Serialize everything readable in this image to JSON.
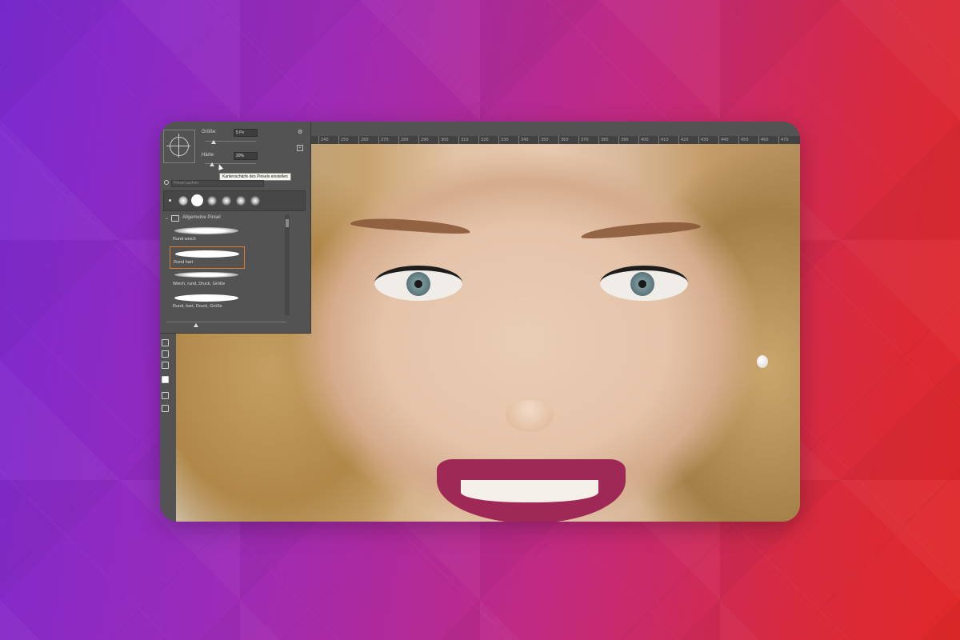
{
  "brush_panel": {
    "size_label": "Größe:",
    "size_value": "5 Px",
    "hardness_label": "Härte:",
    "hardness_value": "20%",
    "tooltip": "Kantenschärfe des Pinsels einstellen",
    "search_placeholder": "Pinsel suchen",
    "folder_label": "Allgemeine Pinsel",
    "brushes": [
      {
        "name": "Rund weich"
      },
      {
        "name": "Rund hart"
      },
      {
        "name": "Weich, rund, Druck, Größe"
      },
      {
        "name": "Rund, hart, Druck, Größe"
      }
    ],
    "selected_brush": "Rund hart"
  },
  "ruler": {
    "ticks": [
      "240",
      "250",
      "260",
      "270",
      "280",
      "290",
      "300",
      "310",
      "320",
      "330",
      "340",
      "350",
      "360",
      "370",
      "380",
      "390",
      "400",
      "410",
      "420",
      "430",
      "440",
      "450",
      "460",
      "470"
    ]
  },
  "colors": {
    "panel_bg": "#535353",
    "selection_accent": "#e07a2f",
    "lips": "#9e2856"
  }
}
